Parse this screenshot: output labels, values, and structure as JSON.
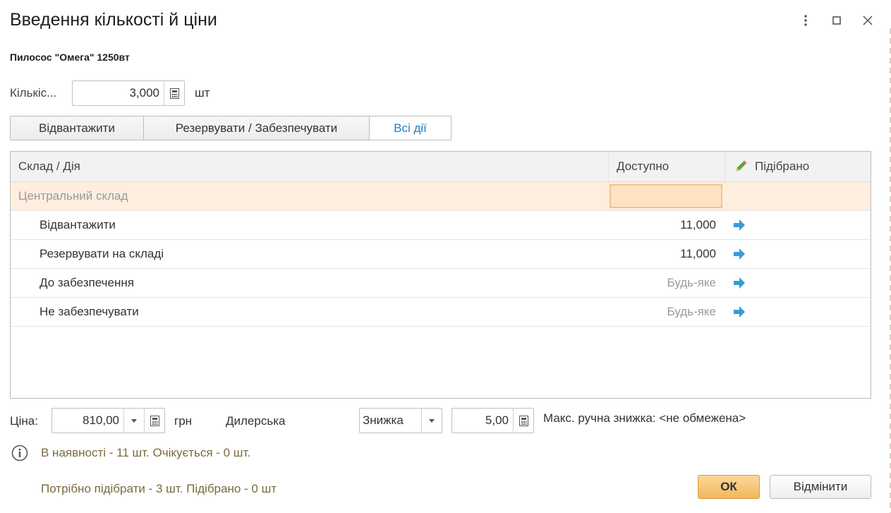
{
  "window": {
    "title": "Введення кількості й ціни"
  },
  "product": {
    "name": "Пилосос \"Омега\" 1250вт"
  },
  "quantity": {
    "label": "Кількіс...",
    "value": "3,000",
    "unit": "шт"
  },
  "tabs": [
    {
      "label": "Відвантажити"
    },
    {
      "label": "Резервувати / Забезпечувати"
    },
    {
      "label": "Всі дії"
    }
  ],
  "table": {
    "headers": {
      "col1": "Склад / Дія",
      "col2": "Доступно",
      "col3": "Підібрано"
    },
    "group": "Центральний склад",
    "rows": [
      {
        "action": "Відвантажити",
        "available": "11,000"
      },
      {
        "action": "Резервувати на складі",
        "available": "11,000"
      },
      {
        "action": "До забезпечення",
        "available": "Будь-яке"
      },
      {
        "action": "Не забезпечувати",
        "available": "Будь-яке"
      }
    ]
  },
  "price": {
    "label": "Ціна:",
    "value": "810,00",
    "currency": "грн",
    "price_type": "Дилерська"
  },
  "discount": {
    "type": "Знижка",
    "value": "5,00",
    "max_text": "Макс. ручна знижка: <не обмежена>"
  },
  "status": {
    "availability": "В наявності - 11 шт. Очікується - 0 шт.",
    "picking": "Потрібно підібрати - 3 шт. Підібрано - 0 шт"
  },
  "buttons": {
    "ok": "ОК",
    "cancel": "Відмінити"
  },
  "colors": {
    "accent": "#f1b65e",
    "link": "#1f7fc0",
    "arrow": "#3a9ad9",
    "selected_row": "#fdeede"
  },
  "icons": [
    "more-icon",
    "maximize-icon",
    "close-icon",
    "calculator-icon",
    "dropdown-icon",
    "pencil-icon",
    "arrow-right-icon",
    "info-icon"
  ]
}
